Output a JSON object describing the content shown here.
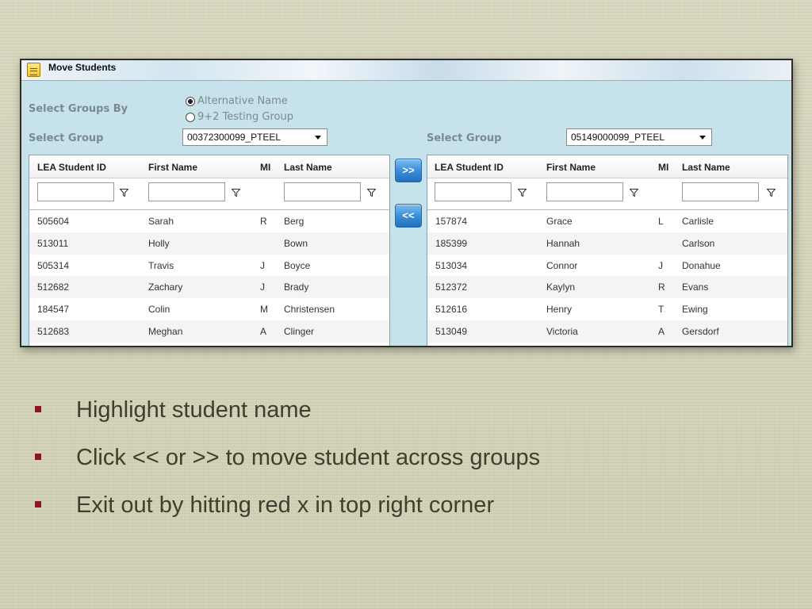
{
  "window": {
    "title": "Move Students",
    "icon": "document-icon"
  },
  "form": {
    "select_groups_by_label": "Select Groups By",
    "radio_options": [
      {
        "label": "Alternative Name",
        "checked": true
      },
      {
        "label": "9+2 Testing Group",
        "checked": false
      }
    ],
    "left_select_label": "Select Group",
    "left_select_value": "00372300099_PTEEL",
    "right_select_label": "Select Group",
    "right_select_value": "05149000099_PTEEL"
  },
  "buttons": {
    "move_right": ">>",
    "move_left": "<<"
  },
  "columns": [
    "LEA Student ID",
    "First Name",
    "MI",
    "Last Name"
  ],
  "left_rows": [
    [
      "505604",
      "Sarah",
      "R",
      "Berg"
    ],
    [
      "513011",
      "Holly",
      "",
      "Bown"
    ],
    [
      "505314",
      "Travis",
      "J",
      "Boyce"
    ],
    [
      "512682",
      "Zachary",
      "J",
      "Brady"
    ],
    [
      "184547",
      "Colin",
      "M",
      "Christensen"
    ],
    [
      "512683",
      "Meghan",
      "A",
      "Clinger"
    ]
  ],
  "right_rows": [
    [
      "157874",
      "Grace",
      "L",
      "Carlisle"
    ],
    [
      "185399",
      "Hannah",
      "",
      "Carlson"
    ],
    [
      "513034",
      "Connor",
      "J",
      "Donahue"
    ],
    [
      "512372",
      "Kaylyn",
      "R",
      "Evans"
    ],
    [
      "512616",
      "Henry",
      "T",
      "Ewing"
    ],
    [
      "513049",
      "Victoria",
      "A",
      "Gersdorf"
    ]
  ],
  "bullets": [
    "Highlight student name",
    "Click << or >> to move student across groups",
    "Exit out by hitting red x in top right corner"
  ],
  "colors": {
    "bullet": "#8e1616",
    "panel": "#c6e2ea",
    "button": "#3b8fd9"
  }
}
